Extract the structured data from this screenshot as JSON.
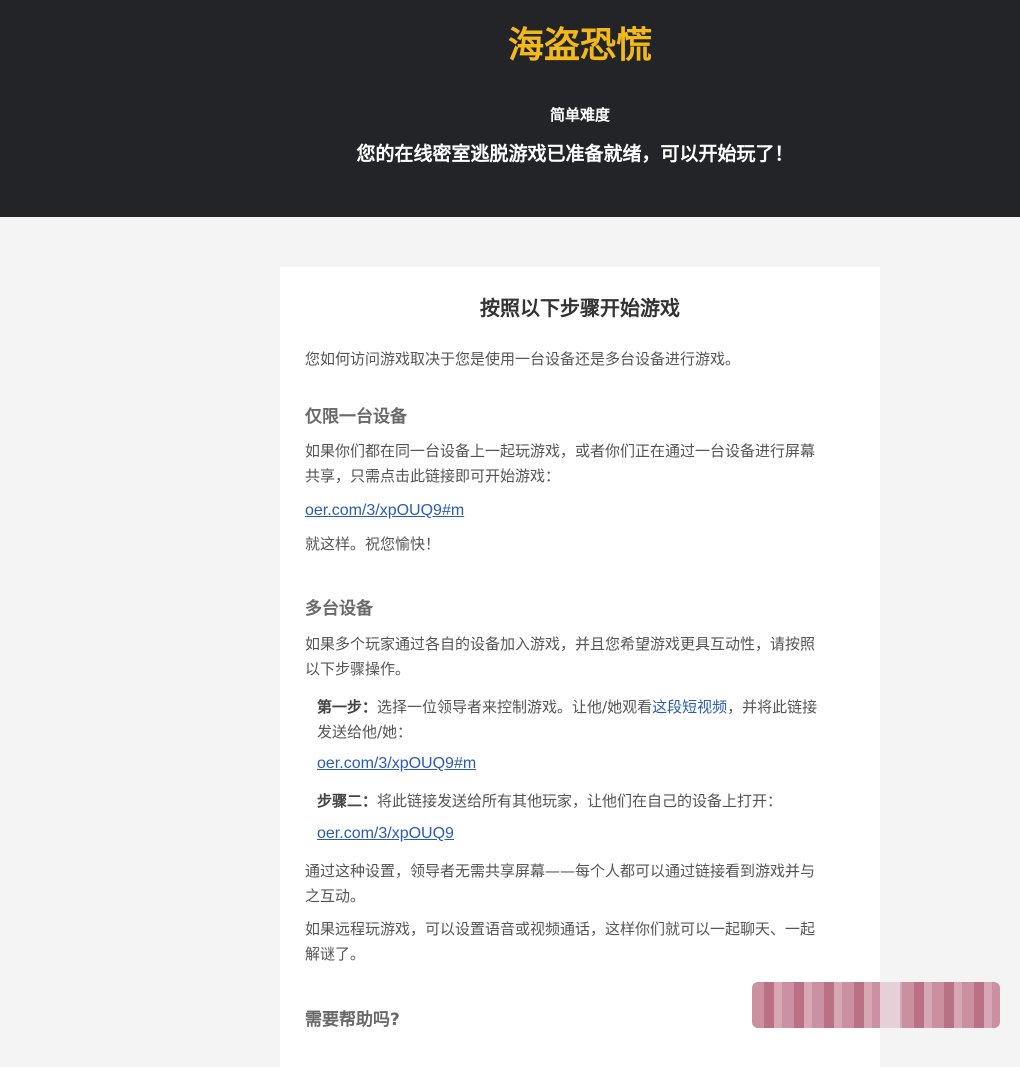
{
  "hero": {
    "title": "海盗恐慌",
    "difficulty": "简单难度",
    "ready": "您的在线密室逃脱游戏已准备就绪，可以开始玩了！"
  },
  "card": {
    "title": "按照以下步骤开始游戏",
    "intro": "您如何访问游戏取决于您是使用一台设备还是多台设备进行游戏。",
    "single": {
      "heading": "仅限一台设备",
      "line1": "如果你们都在同一台设备上一起玩游戏，或者你们正在通过一台设备进行屏幕",
      "line2": "共享，只需点击此链接即可开始游戏：",
      "link": "oer.com/3/xpOUQ9#m",
      "done": "就这样。祝您愉快！"
    },
    "multi": {
      "heading": "多台设备",
      "line1": "如果多个玩家通过各自的设备加入游戏，并且您希望游戏更具互动性，请按照",
      "line2": "以下步骤操作。",
      "step1_label": "第一步：",
      "step1_text": "选择一位领导者来控制游戏。让他/她观看",
      "step1_inline_link": "这段短视频",
      "step1_text2": "，并将此链接",
      "step1_line2": "发送给他/她：",
      "step1_link": "oer.com/3/xpOUQ9#m",
      "step2_label": "步骤二：",
      "step2_text": "将此链接发送给所有其他玩家，让他们在自己的设备上打开：",
      "step2_link": "oer.com/3/xpOUQ9",
      "note1_line1": "通过这种设置，领导者无需共享屏幕——每个人都可以通过链接看到游戏并与",
      "note1_line2": "之互动。",
      "note2_line1": "如果远程玩游戏，可以设置语音或视频通话，这样你们就可以一起聊天、一起",
      "note2_line2": "解谜了。"
    },
    "help": {
      "heading": "需要帮助吗?"
    }
  }
}
